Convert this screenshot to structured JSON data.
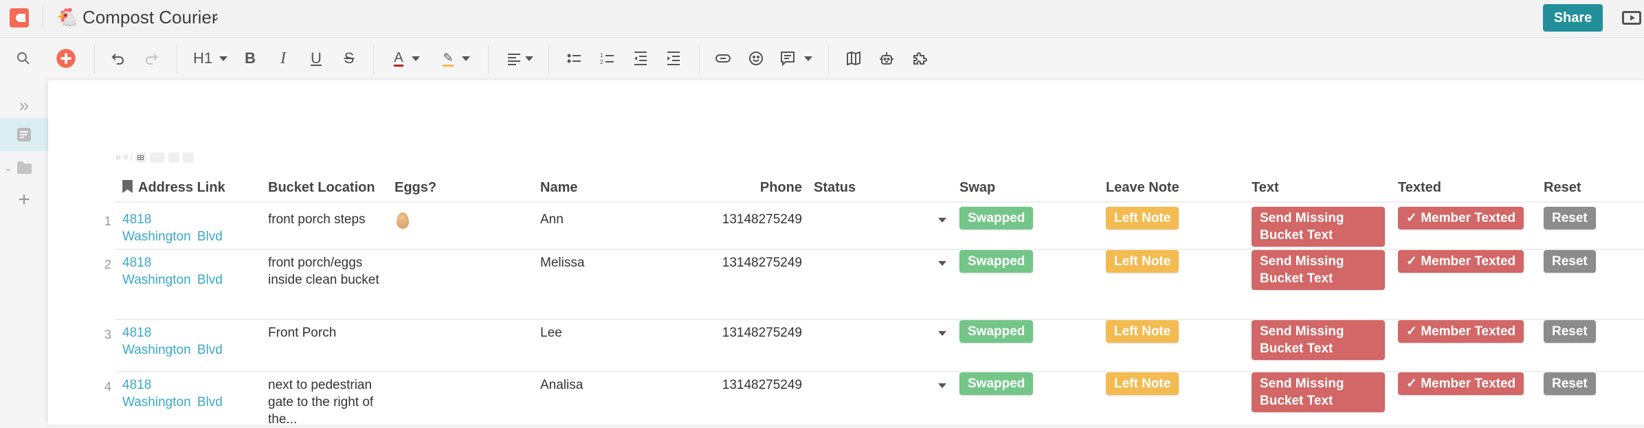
{
  "app": {
    "doc_emoji": "🐔",
    "doc_title": "Compost Courier",
    "share_label": "Share"
  },
  "toolbar": {
    "heading_label": "H1"
  },
  "mini_tools": {
    "comment_count": "0"
  },
  "table": {
    "columns": [
      "Address Link",
      "Bucket Location",
      "Eggs?",
      "Name",
      "Phone",
      "Status",
      "Swap",
      "Leave Note",
      "Text",
      "Texted",
      "Reset"
    ],
    "rows": [
      {
        "num": "1",
        "address": "4818 Washington Blvd",
        "bucket_location": "front porch steps",
        "eggs": "egg",
        "name": "Ann",
        "phone": "13148275249",
        "status": "",
        "swap": "Swapped",
        "leave_note": "Left Note",
        "text": "Send Missing Bucket Text",
        "texted": "✓ Member Texted",
        "reset": "Reset"
      },
      {
        "num": "2",
        "address": "4818 Washington Blvd",
        "bucket_location": "front porch/eggs inside clean bucket",
        "eggs": "",
        "name": "Melissa",
        "phone": "13148275249",
        "status": "",
        "swap": "Swapped",
        "leave_note": "Left Note",
        "text": "Send Missing Bucket Text",
        "texted": "✓ Member Texted",
        "reset": "Reset"
      },
      {
        "num": "3",
        "address": "4818 Washington Blvd",
        "bucket_location": "Front Porch",
        "eggs": "",
        "name": "Lee",
        "phone": "13148275249",
        "status": "",
        "swap": "Swapped",
        "leave_note": "Left Note",
        "text": "Send Missing Bucket Text",
        "texted": "✓ Member Texted",
        "reset": "Reset"
      },
      {
        "num": "4",
        "address": "4818 Washington Blvd",
        "bucket_location": "next to pedestrian gate to the right of the...",
        "eggs": "",
        "name": "Analisa",
        "phone": "13148275249",
        "status": "",
        "swap": "Swapped",
        "leave_note": "Left Note",
        "text": "Send Missing Bucket Text",
        "texted": "✓ Member Texted",
        "reset": "Reset"
      }
    ]
  },
  "colors": {
    "brand": "#f46a54",
    "share": "#238f9b",
    "link": "#3aa9c9",
    "swap": "#74c688",
    "note": "#f3bb51",
    "text_btn": "#d36666",
    "reset": "#8c8c8c"
  }
}
